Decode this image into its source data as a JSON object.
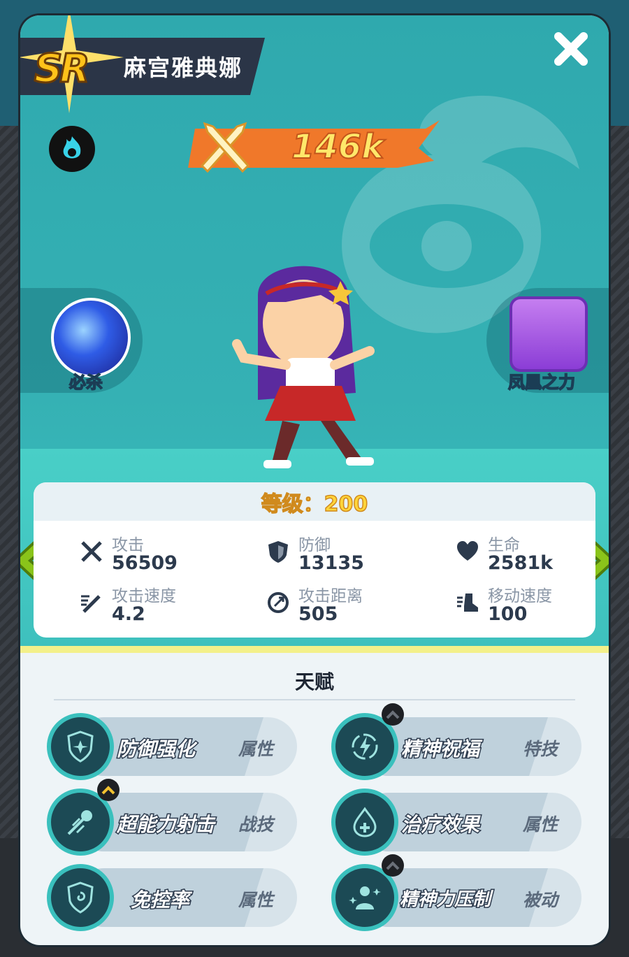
{
  "header": {
    "rarity": "SR",
    "hero_name": "麻宫雅典娜",
    "power": "146k",
    "close_label": ""
  },
  "skills": {
    "ultimate_label": "必杀",
    "passive_label": "凤凰之力"
  },
  "stats": {
    "level_text": "等级：200",
    "items": [
      {
        "label": "攻击",
        "value": "56509",
        "icon": "sword-icon"
      },
      {
        "label": "防御",
        "value": "13135",
        "icon": "shield-icon"
      },
      {
        "label": "生命",
        "value": "2581k",
        "icon": "heart-icon"
      },
      {
        "label": "攻击速度",
        "value": "4.2",
        "icon": "speed-sword-icon"
      },
      {
        "label": "攻击距离",
        "value": "505",
        "icon": "range-icon"
      },
      {
        "label": "移动速度",
        "value": "100",
        "icon": "boot-icon"
      }
    ]
  },
  "talents": {
    "title": "天赋",
    "items": [
      {
        "name": "防御强化",
        "type": "属性",
        "icon": "shield-star-icon",
        "badge": "none"
      },
      {
        "name": "精神祝福",
        "type": "特技",
        "icon": "lightning-cycle-icon",
        "badge": "dark"
      },
      {
        "name": "超能力射击",
        "type": "战技",
        "icon": "psychic-shot-icon",
        "badge": "gold"
      },
      {
        "name": "治疗效果",
        "type": "属性",
        "icon": "heal-drop-icon",
        "badge": "none"
      },
      {
        "name": "免控率",
        "type": "属性",
        "icon": "spiral-shield-icon",
        "badge": "none"
      },
      {
        "name": "精神力压制",
        "type": "被动",
        "icon": "person-sparkle-icon",
        "badge": "dark"
      }
    ]
  },
  "colors": {
    "accent_teal": "#3ac0bd",
    "power_orange": "#f0782a",
    "arrow_green": "#8ac41a",
    "level_gold": "#ffd53a"
  }
}
